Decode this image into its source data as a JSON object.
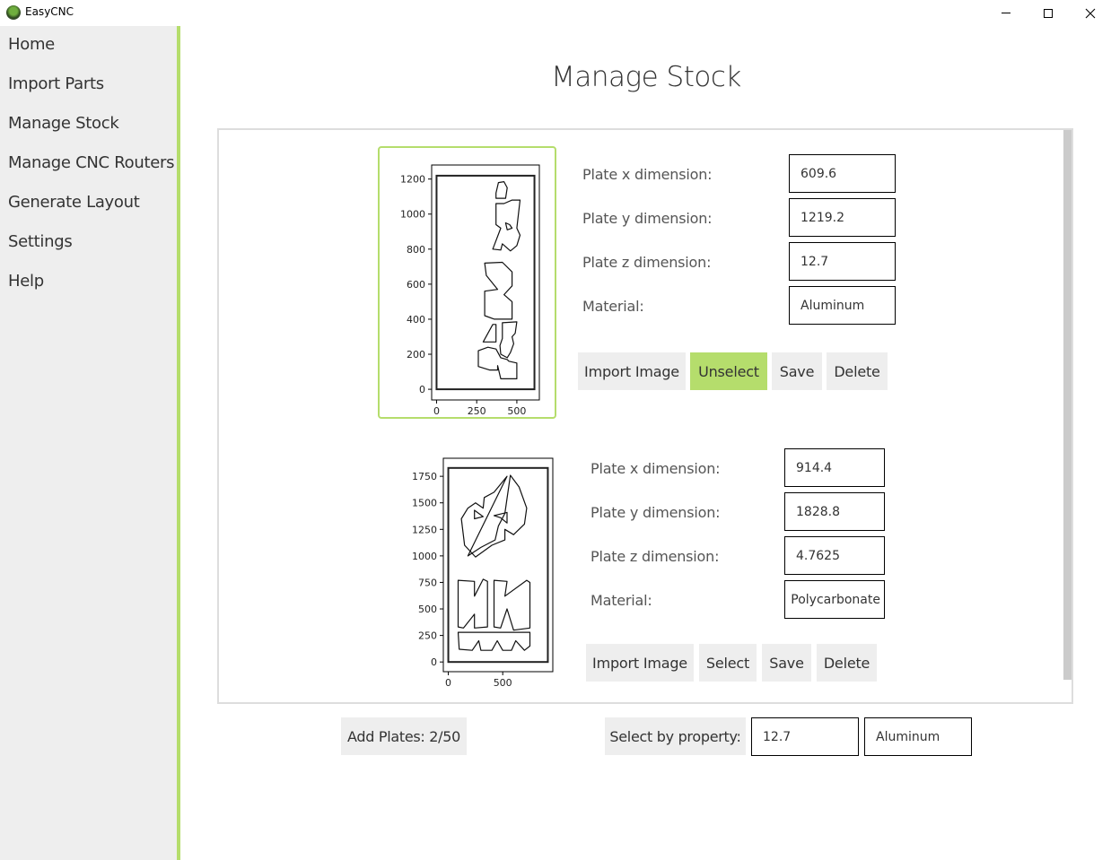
{
  "window": {
    "title": "EasyCNC",
    "minimize_icon": "minimize-icon",
    "maximize_icon": "maximize-icon",
    "close_icon": "close-icon"
  },
  "sidebar": {
    "accent_color": "#b5dd6c",
    "items": [
      {
        "label": "Home"
      },
      {
        "label": "Import Parts"
      },
      {
        "label": "Manage Stock"
      },
      {
        "label": "Manage CNC Routers"
      },
      {
        "label": "Generate Layout"
      },
      {
        "label": "Settings"
      },
      {
        "label": "Help"
      }
    ]
  },
  "page": {
    "title": "Manage Stock"
  },
  "plates": [
    {
      "selected": true,
      "labels": {
        "x": "Plate x dimension:",
        "y": "Plate y dimension:",
        "z": "Plate z dimension:",
        "material": "Material:"
      },
      "values": {
        "x": "609.6",
        "y": "1219.2",
        "z": "12.7",
        "material": "Aluminum"
      },
      "buttons": {
        "import": "Import Image",
        "select": "Unselect",
        "save": "Save",
        "delete": "Delete"
      },
      "preview": {
        "plate_width": 609.6,
        "plate_height": 1219.2,
        "x_ticks": [
          "0",
          "250",
          "500"
        ],
        "y_ticks": [
          "0",
          "200",
          "400",
          "600",
          "800",
          "1000",
          "1200"
        ]
      }
    },
    {
      "selected": false,
      "labels": {
        "x": "Plate x dimension:",
        "y": "Plate y dimension:",
        "z": "Plate z dimension:",
        "material": "Material:"
      },
      "values": {
        "x": "914.4",
        "y": "1828.8",
        "z": "4.7625",
        "material": "Polycarbonate"
      },
      "buttons": {
        "import": "Import Image",
        "select": "Select",
        "save": "Save",
        "delete": "Delete"
      },
      "preview": {
        "plate_width": 914.4,
        "plate_height": 1828.8,
        "x_ticks": [
          "0",
          "500"
        ],
        "y_ticks": [
          "0",
          "250",
          "500",
          "750",
          "1000",
          "1250",
          "1500",
          "1750"
        ]
      }
    }
  ],
  "footer": {
    "add_plates_label": "Add Plates: 2/50",
    "select_by_property_label": "Select by property:",
    "property_thickness": "12.7",
    "property_material": "Aluminum"
  }
}
